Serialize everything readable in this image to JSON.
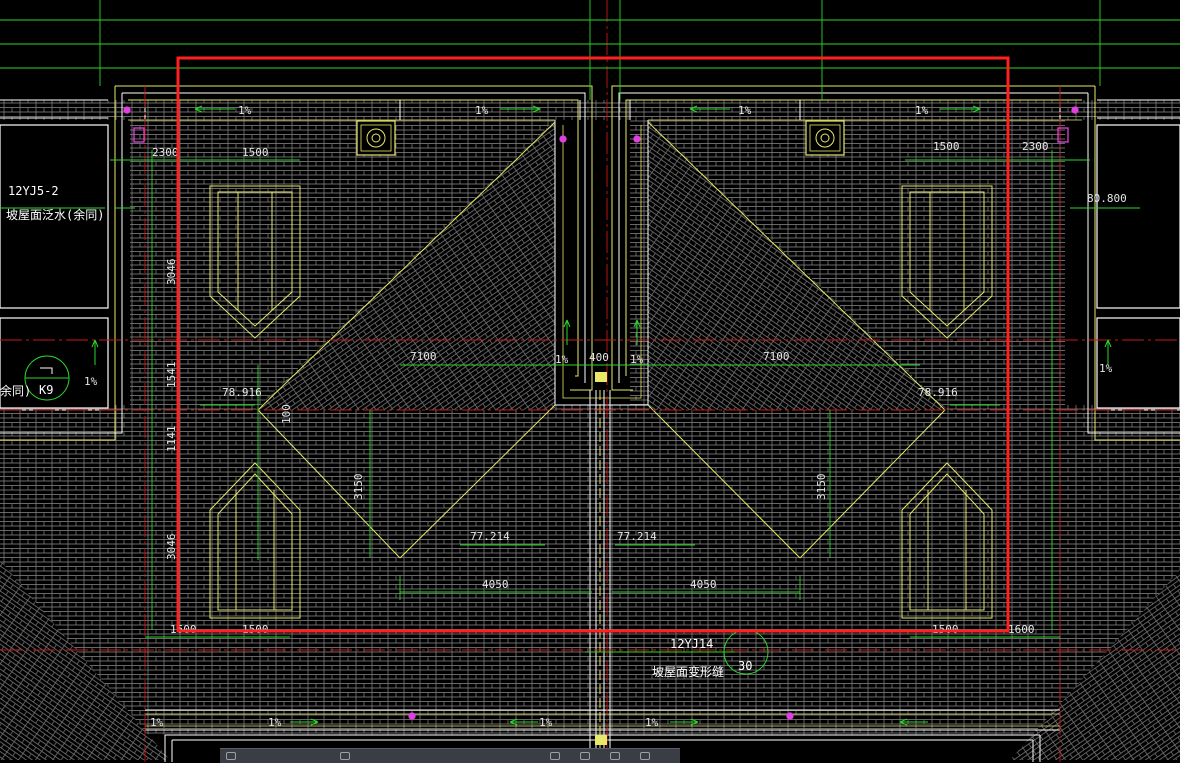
{
  "drawing": {
    "colors": {
      "background": "#000000",
      "roof_hatch": "#8a8a8a",
      "roof_outline": "#e8e86a",
      "dimension": "#2bd62b",
      "axis_line": "#c81818",
      "selection": "#ff2020",
      "wall": "#ffffff",
      "marker": "#e040e0"
    },
    "slopes": {
      "s1": "1%",
      "s2": "1%",
      "s3": "1%",
      "s4": "1%",
      "s5": "1%",
      "s6": "1%",
      "s7": "1%",
      "s8": "1%",
      "s9": "1%",
      "s10": "1%",
      "s11": "1%",
      "s12": "1%"
    },
    "dimensions": {
      "d2300_l": "2300",
      "d1500_tl": "1500",
      "d1500_tr": "1500",
      "d2300_r": "2300",
      "d3046_l": "3046",
      "d1541_l": "1541",
      "d1141_l": "1141",
      "d3046_bl": "3046",
      "d7100_l": "7100",
      "d7100_r": "7100",
      "d400": "400",
      "d100": "100",
      "d3150_l": "3150",
      "d3150_r": "3150",
      "d4050_l": "4050",
      "d4050_r": "4050",
      "d1600_l": "1600",
      "d1500_bl": "1500",
      "d1500_br": "1500",
      "d1600_r": "1600"
    },
    "elevations": {
      "e78_l": "78.916",
      "e78_r": "78.916",
      "e77_l": "77.214",
      "e77_r": "77.214",
      "e80": "80.800"
    },
    "annotations": {
      "std_ref_l": "12YJ5-2",
      "flashing_note": "坡屋面泛水(余同)",
      "flashing_note_partial": "余同)",
      "detail_k9": "K9",
      "std_ref_c": "12YJ14",
      "expansion_joint_note": "坡屋面变形缝",
      "detail_30": "30"
    }
  }
}
